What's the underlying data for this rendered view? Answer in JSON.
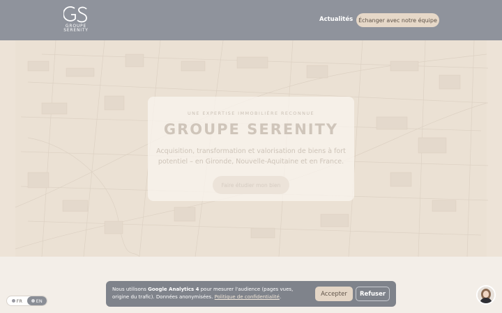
{
  "header": {
    "logo": {
      "monogram": "GS",
      "line1": "GROUPE",
      "line2": "SERENITY"
    },
    "nav_link": "Actualités",
    "cta": "Échanger avec notre équipe"
  },
  "hero": {
    "eyebrow": "UNE EXPERTISE IMMOBILIÈRE RECONNUE",
    "title": "GROUPE SERENITY",
    "subtitle": "Acquisition, transformation et valorisation de biens à fort potentiel – en Gironde, Nouvelle-Aquitaine et en France.",
    "button": "Faire étudier mon bien"
  },
  "cookie": {
    "text_before": "Nous utilisons ",
    "text_bold": "Google Analytics 4",
    "text_after": " pour mesurer l'audience (pages vues, origine du trafic). Données anonymisées. ",
    "link": "Politique de confidentialité",
    "text_end": ".",
    "accept": "Accepter",
    "refuse": "Refuser"
  },
  "language": {
    "options": [
      {
        "code": "FR",
        "active": false
      },
      {
        "code": "EN",
        "active": true
      }
    ]
  },
  "icons": {
    "globe": "globe-icon",
    "chat": "chat-avatar"
  },
  "colors": {
    "header_bg": "#8f939c",
    "cta_bg": "#e6d8c8",
    "cookie_bg": "#7f838b",
    "page_bg": "#f1ebe3"
  }
}
